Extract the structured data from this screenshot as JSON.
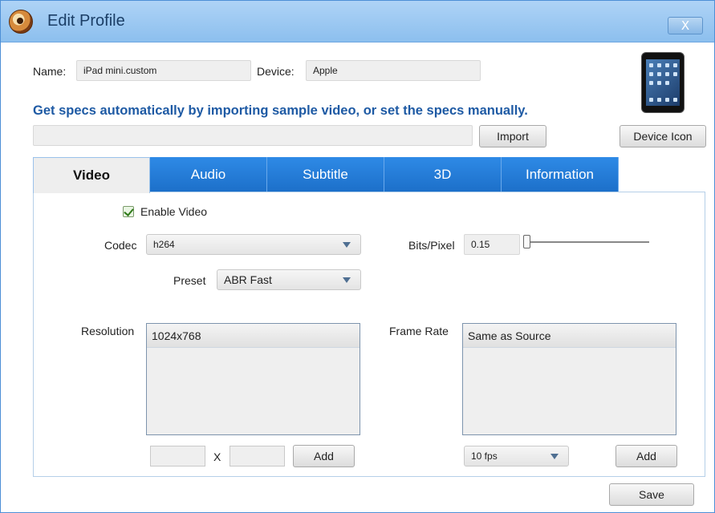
{
  "window": {
    "title": "Edit Profile",
    "close_label": "X"
  },
  "profile": {
    "name_label": "Name:",
    "name_value": "iPad mini.custom",
    "device_label": "Device:",
    "device_value": "Apple"
  },
  "headline": "Get specs automatically by importing sample video, or set the specs manually.",
  "import_path": "",
  "buttons": {
    "import": "Import",
    "device_icon": "Device Icon",
    "save": "Save"
  },
  "tabs": [
    {
      "label": "Video",
      "active": true
    },
    {
      "label": "Audio",
      "active": false
    },
    {
      "label": "Subtitle",
      "active": false
    },
    {
      "label": "3D",
      "active": false
    },
    {
      "label": "Information",
      "active": false
    }
  ],
  "video": {
    "enable_label": "Enable Video",
    "enable_checked": true,
    "codec_label": "Codec",
    "codec_value": "h264",
    "preset_label": "Preset",
    "preset_value": "ABR Fast",
    "bits_label": "Bits/Pixel",
    "bits_value": "0.15",
    "bits_slider_level": 0.0,
    "resolution_label": "Resolution",
    "resolution_items": [
      "1024x768"
    ],
    "res_width": "",
    "res_x": "X",
    "res_height": "",
    "res_add": "Add",
    "framerate_label": "Frame Rate",
    "framerate_items": [
      "Same as Source"
    ],
    "fps_value": "10 fps",
    "fps_add": "Add"
  },
  "colors": {
    "accent": "#1c6fc9",
    "headline": "#1e5aa4"
  }
}
